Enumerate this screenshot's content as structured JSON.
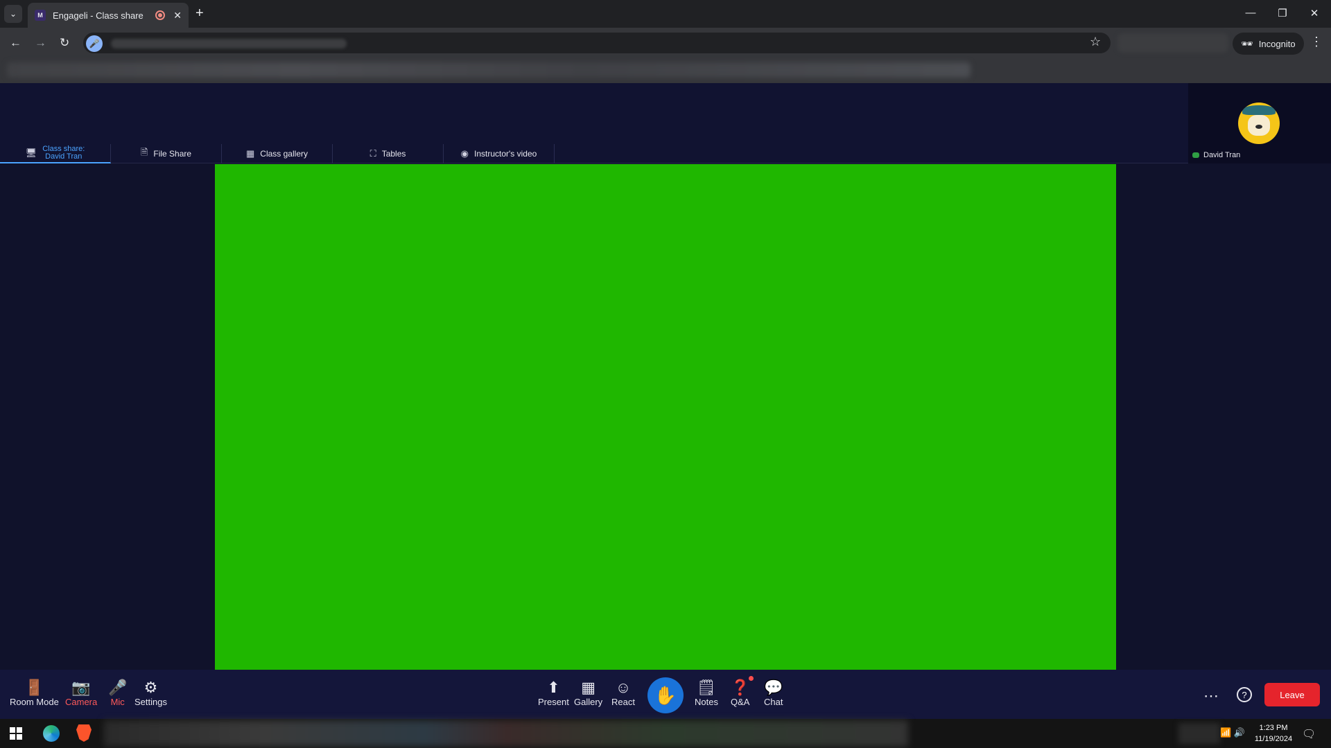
{
  "browser": {
    "tab_title": "Engageli - Class share",
    "tab_favicon_text": "M",
    "new_tab_label": "+",
    "incognito_label": "Incognito"
  },
  "app": {
    "tabs": [
      {
        "label_line1": "Class share:",
        "label_line2": "David Tran",
        "icon": "screen-share-icon"
      },
      {
        "label": "File Share",
        "icon": "file-icon"
      },
      {
        "label": "Class gallery",
        "icon": "grid-icon"
      },
      {
        "label": "Tables",
        "icon": "expand-icon"
      },
      {
        "label": "Instructor's video",
        "icon": "video-icon"
      }
    ],
    "participant_name": "David Tran",
    "share_color": "#1fb700"
  },
  "controls": {
    "room_mode": "Room Mode",
    "camera": "Camera",
    "mic": "Mic",
    "settings": "Settings",
    "present": "Present",
    "gallery": "Gallery",
    "react": "React",
    "notes": "Notes",
    "qa": "Q&A",
    "chat": "Chat",
    "help_glyph": "?",
    "leave": "Leave"
  },
  "taskbar": {
    "time": "1:23 PM",
    "date": "11/19/2024"
  }
}
